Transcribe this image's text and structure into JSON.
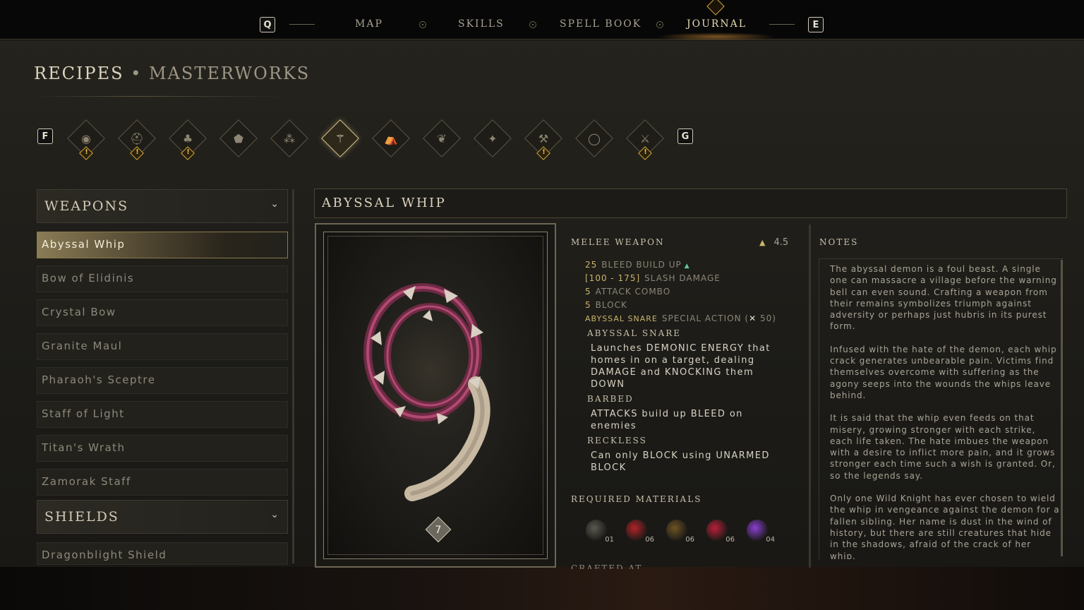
{
  "nav": {
    "left_key": "Q",
    "right_key": "E",
    "items": [
      "MAP",
      "SKILLS",
      "SPELL BOOK",
      "JOURNAL"
    ],
    "active": "JOURNAL"
  },
  "header": {
    "title": "RECIPES",
    "separator": "•",
    "subtitle": "MASTERWORKS"
  },
  "categories": {
    "prev_key": "F",
    "next_key": "G",
    "icons": [
      {
        "name": "eye-icon",
        "glyph": "◉",
        "alert": true
      },
      {
        "name": "helmet-icon",
        "glyph": "⛑",
        "alert": true
      },
      {
        "name": "herb-icon",
        "glyph": "♣",
        "alert": true
      },
      {
        "name": "armor-icon",
        "glyph": "⬟",
        "alert": false
      },
      {
        "name": "cluster-icon",
        "glyph": "⁂",
        "alert": false
      },
      {
        "name": "staff-icon",
        "glyph": "⚚",
        "alert": false,
        "active": true
      },
      {
        "name": "camp-icon",
        "glyph": "⛺",
        "alert": false
      },
      {
        "name": "leaf-icon",
        "glyph": "❦",
        "alert": false
      },
      {
        "name": "spark-icon",
        "glyph": "✦",
        "alert": false
      },
      {
        "name": "pickaxe-icon",
        "glyph": "⚒",
        "alert": true
      },
      {
        "name": "ring-icon",
        "glyph": "◯",
        "alert": false
      },
      {
        "name": "axe-icon",
        "glyph": "⚔",
        "alert": true
      }
    ]
  },
  "list": {
    "groups": [
      {
        "label": "WEAPONS",
        "items": [
          "Abyssal Whip",
          "Bow of Elidinis",
          "Crystal Bow",
          "Granite Maul",
          "Pharaoh's Sceptre",
          "Staff of Light",
          "Titan's Wrath",
          "Zamorak Staff"
        ]
      },
      {
        "label": "SHIELDS",
        "items": [
          "Dragonblight Shield"
        ]
      }
    ],
    "selected": "Abyssal Whip"
  },
  "detail": {
    "name": "ABYSSAL WHIP",
    "tier": "7",
    "type": "MELEE WEAPON",
    "weight": "4.5",
    "stats": [
      {
        "num": "25",
        "label": "BLEED BUILD UP"
      },
      {
        "num": "[100 - 175]",
        "label": "SLASH DAMAGE"
      },
      {
        "num": "5",
        "label": "ATTACK COMBO"
      },
      {
        "num": "5",
        "label": "BLOCK"
      }
    ],
    "special": {
      "name": "ABYSSAL SNARE",
      "label": "SPECIAL ACTION",
      "cost_open": "(",
      "cost_x": "✕",
      "cost": "50)"
    },
    "abilities": [
      {
        "name": "ABYSSAL SNARE",
        "desc": "Launches DEMONIC ENERGY that homes in on a target, dealing DAMAGE and KNOCKING them DOWN"
      },
      {
        "name": "BARBED",
        "desc": "ATTACKS build up BLEED on enemies"
      },
      {
        "name": "RECKLESS",
        "desc": "Can only BLOCK using UNARMED BLOCK"
      }
    ],
    "materials_title": "REQUIRED MATERIALS",
    "materials": [
      {
        "name": "ring-material-icon",
        "qty": "01",
        "color": "#5b5850"
      },
      {
        "name": "potion-material-icon",
        "qty": "06",
        "color": "#b0242a"
      },
      {
        "name": "ore-material-icon",
        "qty": "06",
        "color": "#6e5426"
      },
      {
        "name": "flower-material-icon",
        "qty": "06",
        "color": "#b8203a"
      },
      {
        "name": "crystal-material-icon",
        "qty": "04",
        "color": "#8a3fd0"
      }
    ],
    "crafted_at": "CRAFTED AT"
  },
  "notes": {
    "title": "NOTES",
    "paragraphs": [
      "The abyssal demon is a foul beast. A single one can massacre a village before the warning bell can even sound. Crafting a weapon from their remains symbolizes triumph against adversity or perhaps just hubris in its purest form.",
      "Infused with the hate of the demon, each whip crack generates unbearable pain. Victims find themselves overcome with suffering as the agony seeps into the wounds the whips leave behind.",
      "It is said that the whip even feeds on that misery, growing stronger with each strike, each life taken. The hate imbues the weapon with a desire to inflict more pain, and it grows stronger each time such a wish is granted. Or, so the legends say.",
      "Only one Wild Knight has ever chosen to wield the whip in vengeance against the demon for a fallen sibling. Her name is dust in the wind of history, but there are still creatures that hide in the shadows, afraid of the crack of her whip."
    ]
  },
  "colors": {
    "accent_gold": "#d4a83b",
    "selected_item": "#8a7c55",
    "stat_number": "#c9b46c"
  }
}
